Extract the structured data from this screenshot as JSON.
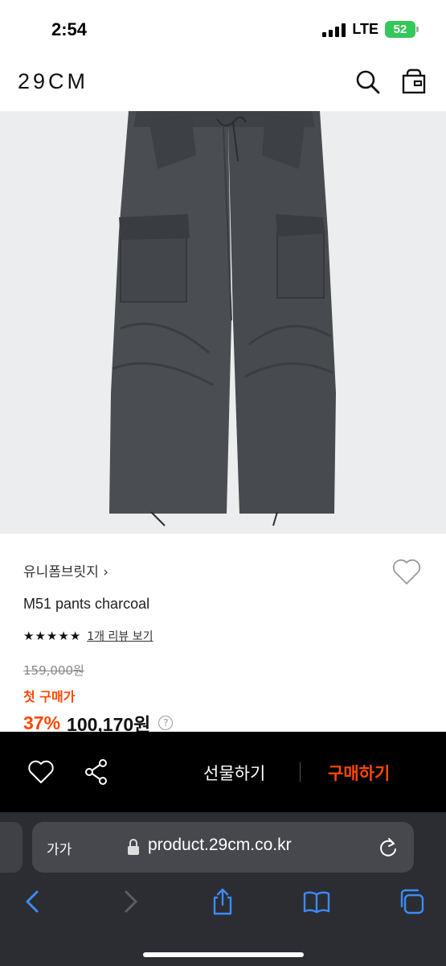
{
  "status": {
    "time": "2:54",
    "network": "LTE",
    "battery": "52"
  },
  "header": {
    "logo": "29CM",
    "search_icon": "search-icon",
    "bag_icon": "shopping-bag-icon"
  },
  "product": {
    "brand": "유니폼브릿지 ›",
    "name": "M51 pants charcoal",
    "rating_stars": 5,
    "review_link": "1개 리뷰 보기",
    "original_price": "159,000원",
    "promo_label": "첫 구매가",
    "discount": "37%",
    "price": "100,170원",
    "help_symbol": "?"
  },
  "actions": {
    "gift_label": "선물하기",
    "buy_label": "구매하기"
  },
  "browser": {
    "text_size_label": "가가",
    "url": "product.29cm.co.kr"
  },
  "colors": {
    "accent": "#ff4800",
    "action_bar": "#000000",
    "browser_bg": "#2b2d33",
    "browser_blue": "#3d8bf5"
  }
}
